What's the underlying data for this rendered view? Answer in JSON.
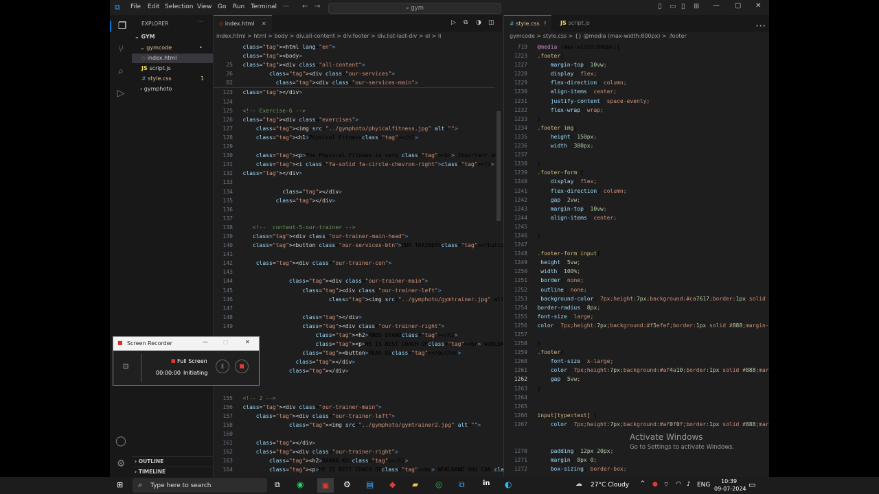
{
  "titlebar": {
    "menus": [
      "File",
      "Edit",
      "Selection",
      "View",
      "Go",
      "Run",
      "Terminal",
      "···"
    ],
    "search": "gym"
  },
  "explorer": {
    "title": "EXPLORER",
    "root": "GYM",
    "items": [
      {
        "label": "gymcode",
        "badge": ""
      },
      {
        "label": "index.html",
        "badge": ""
      },
      {
        "label": "script.js",
        "badge": ""
      },
      {
        "label": "style.css",
        "badge": "1"
      },
      {
        "label": "gymphoto",
        "badge": ""
      }
    ],
    "outline": "OUTLINE",
    "timeline": "TIMELINE"
  },
  "left_editor": {
    "tab": "index.html",
    "breadcrumb": "index.html > html > body > div.all-content > div.footer > div.list-last-div > ol > li",
    "lines": [
      {
        "n": "",
        "t": "<html lang=\"en\">"
      },
      {
        "n": "",
        "t": "<body>"
      },
      {
        "n": "25",
        "t": "<div class=\"all-content\">"
      },
      {
        "n": "26",
        "t": "        <div class=\"our-services\">"
      },
      {
        "n": "82",
        "t": "          <div class=\"our-services-main\">"
      },
      {
        "n": "123",
        "t": "</div>"
      },
      {
        "n": "124",
        "t": ""
      },
      {
        "n": "125",
        "t": "<!-- Exercise-6 -->"
      },
      {
        "n": "126",
        "t": "<div class=\"exercises\">"
      },
      {
        "n": "127",
        "t": "    <img src=\"../gymphoto/phyicalfitness.jpg\" alt=\"\">"
      },
      {
        "n": "128",
        "t": "    <h1>Physical Fitness</h1>"
      },
      {
        "n": "129",
        "t": ""
      },
      {
        "n": "130",
        "t": "    <p>The Physical Fitnees is very <br> Important and best.</p>"
      },
      {
        "n": "131",
        "t": "    <i class=\"fa-solid fa-circle-chevron-right\"></i>"
      },
      {
        "n": "132",
        "t": "</div>"
      },
      {
        "n": "133",
        "t": ""
      },
      {
        "n": "134",
        "t": "            </div>"
      },
      {
        "n": "135",
        "t": "          </div>"
      },
      {
        "n": "136",
        "t": ""
      },
      {
        "n": "137",
        "t": ""
      },
      {
        "n": "138",
        "t": "   <!--  content-5-our-trainer -->"
      },
      {
        "n": "139",
        "t": "   <div class=\"our-trainer-main-head\">"
      },
      {
        "n": "140",
        "t": "   <button class=\"our-services-btn\">OUR TRAINERS</button>"
      },
      {
        "n": "141",
        "t": ""
      },
      {
        "n": "142",
        "t": "    <div class=\"our-trainer-con\">"
      },
      {
        "n": "143",
        "t": ""
      },
      {
        "n": "144",
        "t": "              <div class=\"our-trainer-main\">"
      },
      {
        "n": "145",
        "t": "                  <div class=\"our-trainer-left\">"
      },
      {
        "n": "146",
        "t": "                          <img src=\"../gymphoto/gymtrainer.jpg\" alt=\""
      },
      {
        "n": "147",
        "t": ""
      },
      {
        "n": "148",
        "t": "                  </div>"
      },
      {
        "n": "149",
        "t": "                  <div class=\"our-trainer-right\">"
      },
      {
        "n": "",
        "t": "                      <h2>RNEO STANO</h2>"
      },
      {
        "n": "",
        "t": "                      <p>HE IS BEST COACH OF<br> WORLDAND YOU CAN <br>MAY"
      },
      {
        "n": "",
        "t": "                  <button>READ US</button>"
      },
      {
        "n": "",
        "t": "                </div>"
      },
      {
        "n": "",
        "t": "              </div>"
      },
      {
        "n": "",
        "t": ""
      },
      {
        "n": "",
        "t": ""
      },
      {
        "n": "155",
        "t": "<!-- 2 -->"
      },
      {
        "n": "156",
        "t": "<div class=\"our-trainer-main\">"
      },
      {
        "n": "157",
        "t": "    <div class=\"our-trainer-left\">"
      },
      {
        "n": "158",
        "t": "              <img src=\"../gymphoto/gymtrainer2.jpg\" alt=\"\">"
      },
      {
        "n": "160",
        "t": ""
      },
      {
        "n": "161",
        "t": "    </div>"
      },
      {
        "n": "162",
        "t": "    <div class=\"our-trainer-right\">"
      },
      {
        "n": "163",
        "t": "        <h2>RAMAN KOL</h2>"
      },
      {
        "n": "164",
        "t": "        <p>HE IS BEST COACH OF<br> WORLDAND YOU CAN <br>MAY TO USEHE IS B"
      },
      {
        "n": "165",
        "t": "    <button>READ US</button>"
      }
    ]
  },
  "right_editor": {
    "tabs": [
      "style.css",
      "script.js"
    ],
    "tab_flag": "!",
    "breadcrumb": "gymcode > style.css > {} @media (max-width:800px) > .footer",
    "lines": [
      {
        "n": "719",
        "t": "@media (max-width:800px){"
      },
      {
        "n": "1223",
        "t": ".footer{"
      },
      {
        "n": "1227",
        "t": "    margin-top: 10vw;"
      },
      {
        "n": "1228",
        "t": "    display: flex;"
      },
      {
        "n": "1229",
        "t": "    flex-direction: column;"
      },
      {
        "n": "1230",
        "t": "    align-items: center;"
      },
      {
        "n": "1231",
        "t": "    justify-content: space-evenly;"
      },
      {
        "n": "1232",
        "t": "    flex-wrap: wrap;"
      },
      {
        "n": "1233",
        "t": "}"
      },
      {
        "n": "1234",
        "t": ".footer img{"
      },
      {
        "n": "1235",
        "t": "    height: 150px;"
      },
      {
        "n": "1236",
        "t": "    width: 300px;"
      },
      {
        "n": "1237",
        "t": ""
      },
      {
        "n": "1238",
        "t": "}"
      },
      {
        "n": "1239",
        "t": ".footer-form {"
      },
      {
        "n": "1240",
        "t": "    display: flex;"
      },
      {
        "n": "1241",
        "t": "    flex-direction: column;"
      },
      {
        "n": "1242",
        "t": "    gap: 2vw;"
      },
      {
        "n": "1243",
        "t": "    margin-top: 10vw;"
      },
      {
        "n": "1244",
        "t": "    align-items: center;"
      },
      {
        "n": "1245",
        "t": ""
      },
      {
        "n": "1246",
        "t": "}"
      },
      {
        "n": "1247",
        "t": ""
      },
      {
        "n": "1248",
        "t": ".footer-form input{"
      },
      {
        "n": "1249",
        "t": " height: 5vw;"
      },
      {
        "n": "1250",
        "t": " width: 100%;"
      },
      {
        "n": "1251",
        "t": " border: none;"
      },
      {
        "n": "1252",
        "t": " outline: none;"
      },
      {
        "n": "1253",
        "t": " background-color: ■rgb(202, 118, 23);"
      },
      {
        "n": "1254",
        "t": "border-radius: 8px;"
      },
      {
        "n": "1255",
        "t": "font-size: large;"
      },
      {
        "n": "1256",
        "t": "color: □rgb(245, 239, 239);"
      },
      {
        "n": "1257",
        "t": ""
      },
      {
        "n": "1258",
        "t": "}"
      },
      {
        "n": "1259",
        "t": ".footer{"
      },
      {
        "n": "1260",
        "t": "    font-size: x-large;"
      },
      {
        "n": "1261",
        "t": "    color: ■rgb(175, 74, 16);"
      },
      {
        "n": "1262",
        "t": "    gap: 5vw;"
      },
      {
        "n": "1263",
        "t": "}"
      },
      {
        "n": "1264",
        "t": ""
      },
      {
        "n": "1265",
        "t": ""
      },
      {
        "n": "1266",
        "t": "input[type=text] {"
      },
      {
        "n": "1267",
        "t": "    color: ■rgb(175, 15, 15);"
      },
      {
        "n": "",
        "t": ""
      },
      {
        "n": "",
        "t": ""
      },
      {
        "n": "1270",
        "t": "    padding: 12px 20px;"
      },
      {
        "n": "1271",
        "t": "    margin: 8px 0;"
      },
      {
        "n": "1272",
        "t": "    box-sizing: border-box;"
      }
    ],
    "current_line": "1262"
  },
  "recorder": {
    "title": "Screen Recorder",
    "mode": "Full Screen",
    "time": "00:00:00",
    "status": "Initiating"
  },
  "watermark": {
    "title": "Activate Windows",
    "subtitle": "Go to Settings to activate Windows."
  },
  "taskbar": {
    "search_placeholder": "Type here to search",
    "weather": "27°C  Cloudy",
    "lang": "ENG",
    "time": "10:39",
    "date": "09-07-2024"
  },
  "colors": {
    "swatch1": "#ca7617",
    "swatch2": "#f5efef",
    "swatch3": "#af4a10",
    "swatch4": "#af0f0f"
  }
}
